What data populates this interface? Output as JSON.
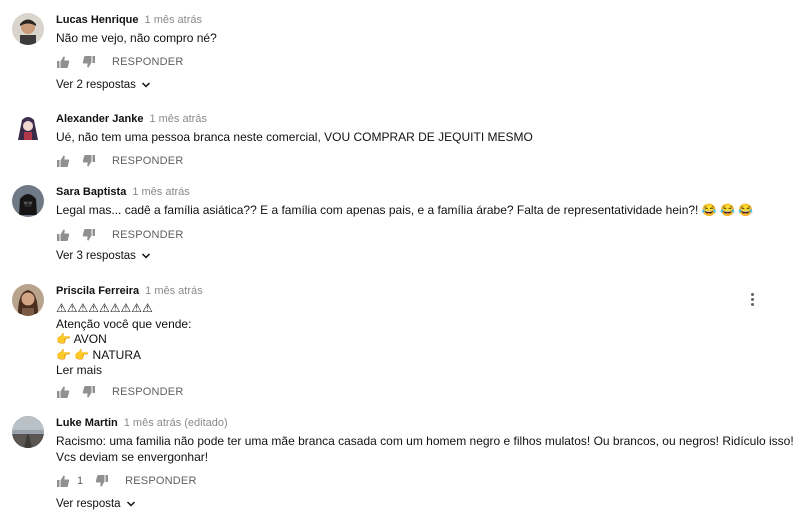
{
  "comments": [
    {
      "author": "Lucas Henrique",
      "time": "1 mês atrás",
      "lines": [
        "Não me vejo, não compro né?"
      ],
      "reply_label": "RESPONDER",
      "replies_label": "Ver 2 respostas"
    },
    {
      "author": "Alexander Janke",
      "time": "1 mês atrás",
      "lines": [
        "Ué, não tem uma pessoa branca neste comercial, VOU COMPRAR DE JEQUITI MESMO"
      ],
      "reply_label": "RESPONDER"
    },
    {
      "author": "Sara Baptista",
      "time": "1 mês atrás",
      "lines": [
        "Legal mas... cadê a família asiática?? E a família com apenas pais, e a família árabe? Falta de representatividade hein?! 😂 😂 😂"
      ],
      "reply_label": "RESPONDER",
      "replies_label": "Ver 3 respostas"
    },
    {
      "author": "Priscila Ferreira",
      "time": "1 mês atrás",
      "lines": [
        "⚠⚠⚠⚠⚠⚠⚠⚠⚠",
        "Atenção você que vende:",
        "👉 AVON",
        "👉 👉 NATURA"
      ],
      "more_label": "Ler mais",
      "reply_label": "RESPONDER"
    },
    {
      "author": "Luke Martin",
      "time": "1 mês atrás (editado)",
      "lines": [
        "Racismo: uma familia não pode ter uma mãe branca casada com um homem negro e filhos mulatos! Ou brancos, ou negros! Ridículo isso!",
        "Vcs deviam se envergonhar!"
      ],
      "like_count": "1",
      "reply_label": "RESPONDER",
      "replies_label": "Ver resposta"
    }
  ],
  "icons": {
    "like": "thumbs-up-icon",
    "dislike": "thumbs-down-icon",
    "expand": "chevron-down-icon",
    "menu": "more-vert-icon"
  },
  "colors": {
    "text": "#111111",
    "secondary": "#8a8a8a",
    "icon": "#909090"
  }
}
